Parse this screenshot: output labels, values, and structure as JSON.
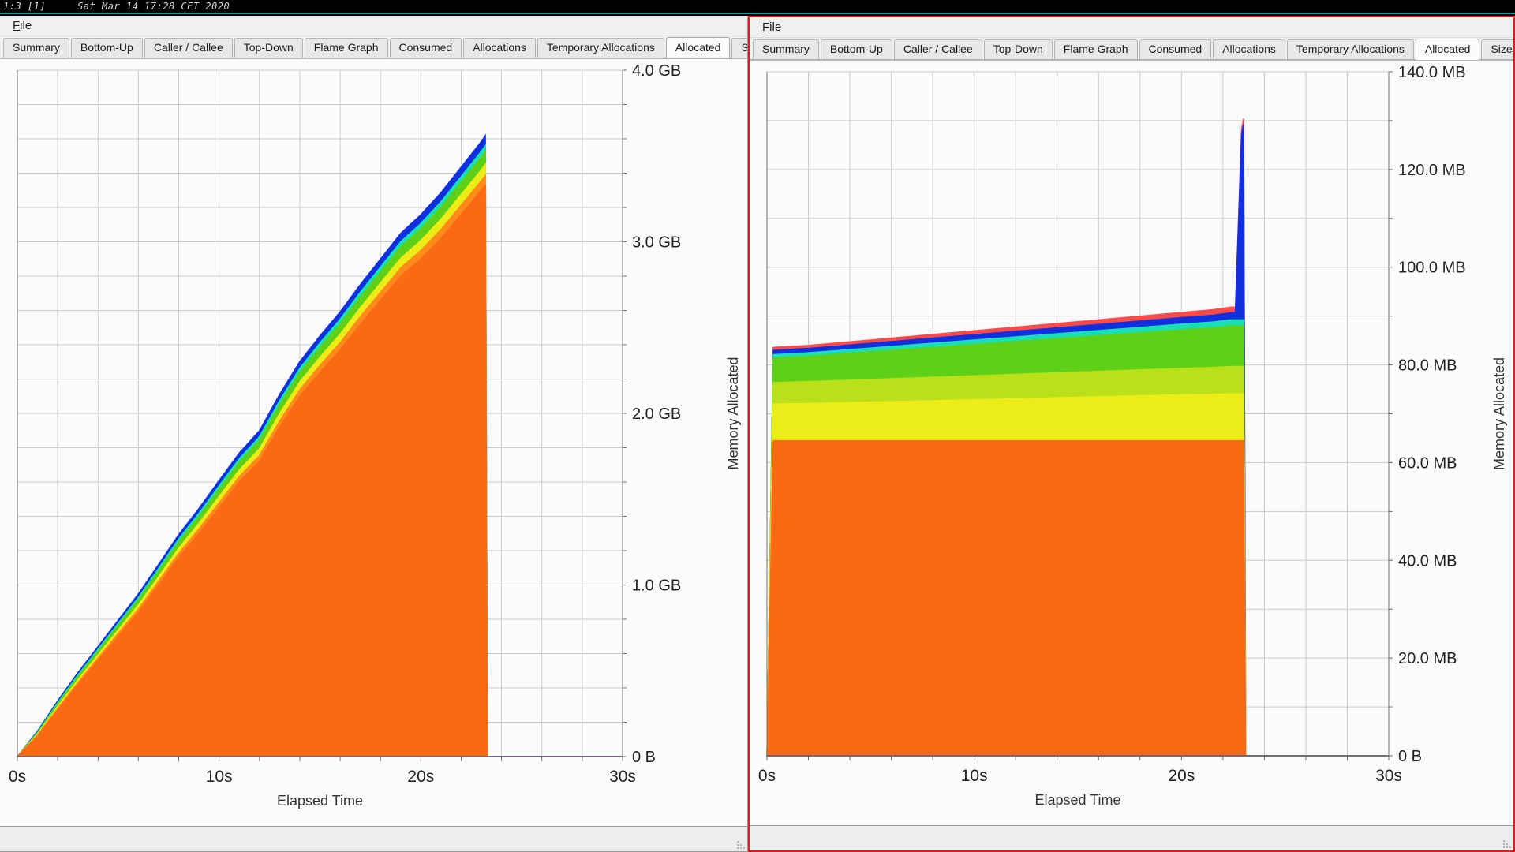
{
  "tmux_status": {
    "window_index": "1:3 [1]",
    "clock": "Sat Mar 14 17:28 CET 2020"
  },
  "colors": {
    "accent_focus_border": "#e01b1b",
    "tmux_accent": "#1a9a9a",
    "window_bg": "#f0f0f0",
    "plot_bg": "#fbfbfb",
    "grid": "#c9c9c9",
    "series_orange": "#fa6a14",
    "series_orange2": "#ff8c1a",
    "series_yellow": "#ecec18",
    "series_yellowgreen": "#b9e018",
    "series_green": "#5ed018",
    "series_cyan": "#18e0b4",
    "series_blue": "#1030e0",
    "series_red": "#ff4a4a"
  },
  "windows": [
    {
      "id": "left",
      "focused": false,
      "menu": [
        {
          "label": "File",
          "mnemonic": "F"
        }
      ],
      "tabs": [
        {
          "label": "Summary",
          "selected": false
        },
        {
          "label": "Bottom-Up",
          "selected": false
        },
        {
          "label": "Caller / Callee",
          "selected": false
        },
        {
          "label": "Top-Down",
          "selected": false
        },
        {
          "label": "Flame Graph",
          "selected": false
        },
        {
          "label": "Consumed",
          "selected": false
        },
        {
          "label": "Allocations",
          "selected": false
        },
        {
          "label": "Temporary Allocations",
          "selected": false
        },
        {
          "label": "Allocated",
          "selected": true
        },
        {
          "label": "Sizes",
          "selected": false
        }
      ],
      "chart_data": {
        "type": "area",
        "stacked": true,
        "title": "",
        "xlabel": "Elapsed Time",
        "ylabel": "Memory Allocated",
        "xlim": [
          0,
          30
        ],
        "ylim": [
          0,
          4
        ],
        "xunit": "s",
        "yunit": "GB",
        "grid": true,
        "legend": "none",
        "xticks": [
          0,
          10,
          20,
          30
        ],
        "xticklabels": [
          "0s",
          "10s",
          "20s",
          "30s"
        ],
        "xminor_step": 2,
        "yticks": [
          0,
          1,
          2,
          3,
          4
        ],
        "yticklabels": [
          "0 B",
          "1.0 GB",
          "2.0 GB",
          "3.0 GB",
          "4.0 GB"
        ],
        "yminor_step": 0.2,
        "x": [
          0,
          1,
          2,
          3,
          4,
          5,
          6,
          7,
          8,
          9,
          10,
          11,
          12,
          13,
          14,
          15,
          16,
          17,
          18,
          19,
          20,
          21,
          22,
          23,
          23.2,
          23.3,
          30
        ],
        "series": [
          {
            "name": "series-orange",
            "color": "#fa6a14",
            "values": [
              0.0,
              0.12,
              0.27,
              0.42,
              0.56,
              0.7,
              0.84,
              1.0,
              1.16,
              1.3,
              1.45,
              1.6,
              1.72,
              1.92,
              2.1,
              2.24,
              2.37,
              2.52,
              2.66,
              2.8,
              2.9,
              3.02,
              3.16,
              3.3,
              3.33,
              0.0,
              0.0
            ]
          },
          {
            "name": "series-orange-light",
            "color": "#ff8c1a",
            "values": [
              0.0,
              0.005,
              0.01,
              0.012,
              0.015,
              0.018,
              0.02,
              0.022,
              0.025,
              0.027,
              0.03,
              0.032,
              0.034,
              0.036,
              0.038,
              0.04,
              0.042,
              0.044,
              0.046,
              0.048,
              0.05,
              0.052,
              0.054,
              0.056,
              0.057,
              0.0,
              0.0
            ]
          },
          {
            "name": "series-yellow",
            "color": "#ecec18",
            "values": [
              0.0,
              0.006,
              0.012,
              0.015,
              0.018,
              0.021,
              0.024,
              0.027,
              0.03,
              0.033,
              0.036,
              0.038,
              0.04,
              0.043,
              0.046,
              0.048,
              0.05,
              0.052,
              0.054,
              0.056,
              0.058,
              0.06,
              0.062,
              0.064,
              0.065,
              0.0,
              0.0
            ]
          },
          {
            "name": "series-green",
            "color": "#5ed018",
            "values": [
              0.0,
              0.008,
              0.015,
              0.019,
              0.022,
              0.026,
              0.029,
              0.032,
              0.036,
              0.039,
              0.042,
              0.045,
              0.048,
              0.051,
              0.054,
              0.057,
              0.06,
              0.062,
              0.064,
              0.066,
              0.068,
              0.07,
              0.072,
              0.074,
              0.075,
              0.0,
              0.0
            ]
          },
          {
            "name": "series-cyan",
            "color": "#18e0b4",
            "values": [
              0.0,
              0.004,
              0.007,
              0.009,
              0.011,
              0.012,
              0.014,
              0.016,
              0.017,
              0.019,
              0.02,
              0.021,
              0.022,
              0.024,
              0.025,
              0.026,
              0.027,
              0.028,
              0.029,
              0.03,
              0.031,
              0.032,
              0.033,
              0.034,
              0.035,
              0.0,
              0.0
            ]
          },
          {
            "name": "series-blue",
            "color": "#1030e0",
            "values": [
              0.0,
              0.006,
              0.011,
              0.014,
              0.016,
              0.018,
              0.021,
              0.023,
              0.026,
              0.028,
              0.031,
              0.033,
              0.035,
              0.037,
              0.039,
              0.041,
              0.043,
              0.045,
              0.047,
              0.049,
              0.051,
              0.053,
              0.055,
              0.057,
              0.058,
              0.0,
              0.0
            ]
          }
        ]
      }
    },
    {
      "id": "right",
      "focused": true,
      "menu": [
        {
          "label": "File",
          "mnemonic": "F"
        }
      ],
      "tabs": [
        {
          "label": "Summary",
          "selected": false
        },
        {
          "label": "Bottom-Up",
          "selected": false
        },
        {
          "label": "Caller / Callee",
          "selected": false
        },
        {
          "label": "Top-Down",
          "selected": false
        },
        {
          "label": "Flame Graph",
          "selected": false
        },
        {
          "label": "Consumed",
          "selected": false
        },
        {
          "label": "Allocations",
          "selected": false
        },
        {
          "label": "Temporary Allocations",
          "selected": false
        },
        {
          "label": "Allocated",
          "selected": true
        },
        {
          "label": "Sizes",
          "selected": false
        }
      ],
      "chart_data": {
        "type": "area",
        "stacked": true,
        "title": "",
        "xlabel": "Elapsed Time",
        "ylabel": "Memory Allocated",
        "xlim": [
          0,
          30
        ],
        "ylim": [
          0,
          140
        ],
        "xunit": "s",
        "yunit": "MB",
        "grid": true,
        "legend": "none",
        "xticks": [
          0,
          10,
          20,
          30
        ],
        "xticklabels": [
          "0s",
          "10s",
          "20s",
          "30s"
        ],
        "xminor_step": 2,
        "yticks": [
          0,
          20,
          40,
          60,
          80,
          100,
          120,
          140
        ],
        "yticklabels": [
          "0 B",
          "20.0 MB",
          "40.0 MB",
          "60.0 MB",
          "80.0 MB",
          "100.0 MB",
          "120.0 MB",
          "140.0 MB"
        ],
        "yminor_step": 10,
        "x": [
          0,
          0.3,
          2,
          4,
          6,
          8,
          10,
          12,
          14,
          16,
          18,
          20,
          21.5,
          22.4,
          22.6,
          22.9,
          23.0,
          23.1,
          30
        ],
        "series": [
          {
            "name": "series-orange",
            "color": "#fa6a14",
            "values": [
              0,
              64.5,
              64.5,
              64.5,
              64.5,
              64.5,
              64.5,
              64.5,
              64.5,
              64.5,
              64.5,
              64.5,
              64.5,
              64.5,
              64.5,
              64.5,
              64.5,
              0,
              0
            ]
          },
          {
            "name": "series-yellow",
            "color": "#ecec18",
            "values": [
              0,
              7.5,
              7.6,
              7.8,
              8.0,
              8.2,
              8.4,
              8.6,
              8.8,
              9.0,
              9.2,
              9.4,
              9.5,
              9.6,
              9.6,
              9.6,
              9.6,
              0,
              0
            ]
          },
          {
            "name": "series-yellowgreen",
            "color": "#b9e018",
            "values": [
              0,
              4.4,
              4.5,
              4.6,
              4.7,
              4.8,
              4.9,
              5.0,
              5.1,
              5.2,
              5.3,
              5.4,
              5.5,
              5.6,
              5.6,
              5.6,
              5.6,
              0,
              0
            ]
          },
          {
            "name": "series-green",
            "color": "#5ed018",
            "values": [
              0,
              5.0,
              5.2,
              5.5,
              5.8,
              6.1,
              6.4,
              6.7,
              7.0,
              7.3,
              7.6,
              7.9,
              8.1,
              8.3,
              8.3,
              8.3,
              8.3,
              0,
              0
            ]
          },
          {
            "name": "series-cyan",
            "color": "#18e0b4",
            "values": [
              0,
              0.7,
              0.7,
              0.75,
              0.8,
              0.85,
              0.9,
              0.95,
              1.0,
              1.05,
              1.1,
              1.15,
              1.2,
              1.25,
              1.25,
              1.25,
              1.25,
              0,
              0
            ]
          },
          {
            "name": "series-blue",
            "color": "#1030e0",
            "values": [
              0,
              0.9,
              0.9,
              0.95,
              1.0,
              1.05,
              1.1,
              1.15,
              1.2,
              1.25,
              1.3,
              1.35,
              1.4,
              1.45,
              1.45,
              38.0,
              40.0,
              0,
              0
            ]
          },
          {
            "name": "series-red",
            "color": "#ff4a4a",
            "values": [
              0,
              0.6,
              0.6,
              0.65,
              0.7,
              0.75,
              0.8,
              0.85,
              0.9,
              0.95,
              1.0,
              1.05,
              1.1,
              1.15,
              1.15,
              1.2,
              1.2,
              0,
              0
            ]
          }
        ]
      }
    }
  ]
}
